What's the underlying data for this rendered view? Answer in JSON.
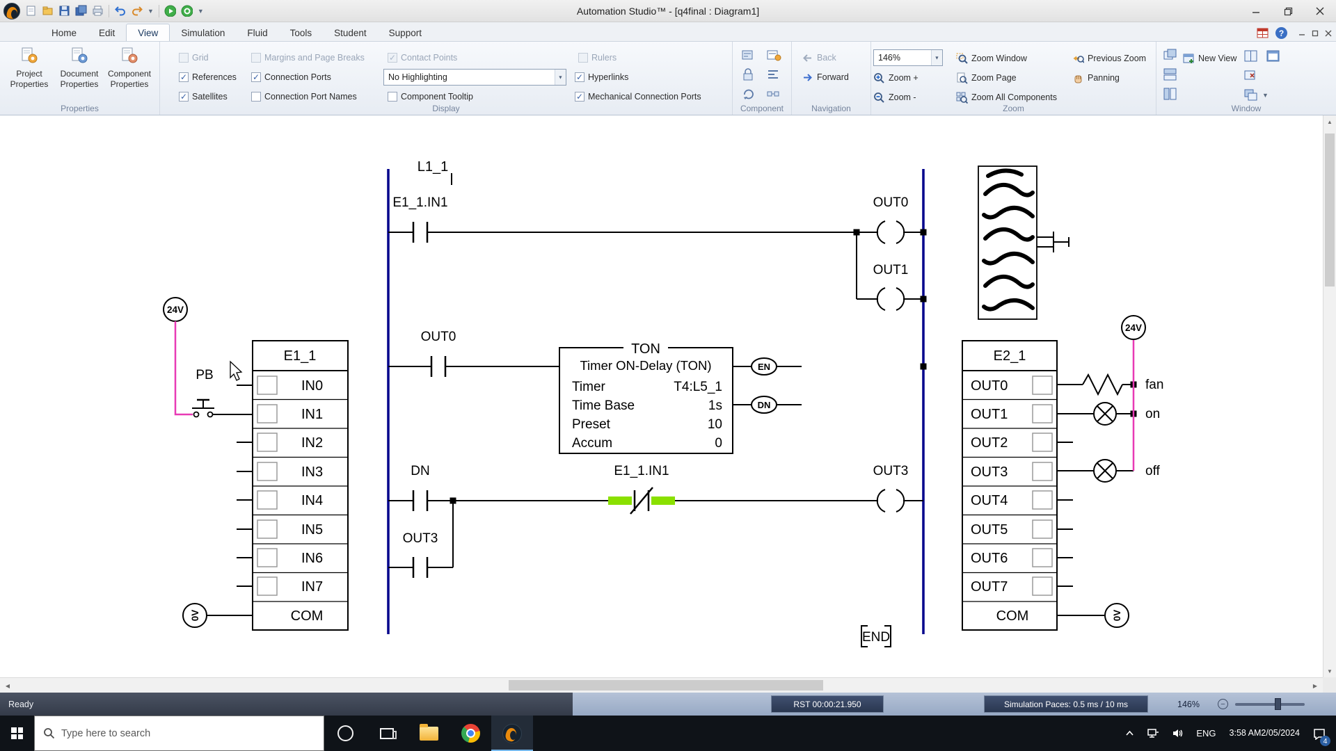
{
  "titlebar": {
    "title": "Automation Studio™ - [q4final : Diagram1]"
  },
  "menubar": {
    "tabs": [
      {
        "label": "Home"
      },
      {
        "label": "Edit"
      },
      {
        "label": "View"
      },
      {
        "label": "Simulation"
      },
      {
        "label": "Fluid"
      },
      {
        "label": "Tools"
      },
      {
        "label": "Student"
      },
      {
        "label": "Support"
      }
    ]
  },
  "ribbon": {
    "properties": {
      "label": "Properties",
      "project": "Project Properties",
      "document": "Document Properties",
      "component": "Component Properties"
    },
    "display": {
      "label": "Display",
      "grid": "Grid",
      "references": "References",
      "satellites": "Satellites",
      "margins": "Margins and Page Breaks",
      "connection_ports": "Connection Ports",
      "connection_port_names": "Connection Port Names",
      "contact_points": "Contact Points",
      "highlighting": "No Highlighting",
      "component_tooltip": "Component Tooltip",
      "rulers": "Rulers",
      "hyperlinks": "Hyperlinks",
      "mechanical": "Mechanical Connection Ports"
    },
    "component": {
      "label": "Component"
    },
    "navigation": {
      "label": "Navigation",
      "back": "Back",
      "forward": "Forward"
    },
    "zoom": {
      "label": "Zoom",
      "value": "146%",
      "window": "Zoom Window",
      "page": "Zoom Page",
      "plus": "Zoom +",
      "minus": "Zoom -",
      "all": "Zoom All Components",
      "previous": "Previous Zoom",
      "panning": "Panning"
    },
    "window": {
      "label": "Window",
      "new_view": "New View"
    }
  },
  "diagram": {
    "colors": {
      "rail": "#00008b",
      "wire": "#e83ab5",
      "highlight": "#8ae000"
    },
    "branch_label": "L1_1",
    "rung1": {
      "contact": "E1_1.IN1",
      "coil_a": "OUT0",
      "coil_b": "OUT1"
    },
    "rung2": {
      "contact": "OUT0",
      "en": "EN",
      "dn": "DN",
      "ton_title": "TON",
      "ton_subtitle": "Timer ON-Delay (TON)",
      "timer_label": "Timer",
      "timer_value": "T4:L5_1",
      "timebase_label": "Time Base",
      "timebase_value": "1s",
      "preset_label": "Preset",
      "preset_value": "10",
      "accum_label": "Accum",
      "accum_value": "0"
    },
    "rung3": {
      "contact_a": "DN",
      "contact_b": "OUT3",
      "nc_contact": "E1_1.IN1",
      "coil": "OUT3"
    },
    "end_label": "END",
    "left_module": {
      "title": "E1_1",
      "rows": [
        "IN0",
        "IN1",
        "IN2",
        "IN3",
        "IN4",
        "IN5",
        "IN6",
        "IN7"
      ],
      "com": "COM",
      "supply": "24V",
      "ground": "0V",
      "pb": "PB"
    },
    "right_module": {
      "title": "E2_1",
      "rows": [
        "OUT0",
        "OUT1",
        "OUT2",
        "OUT3",
        "OUT4",
        "OUT5",
        "OUT6",
        "OUT7"
      ],
      "com": "COM",
      "supply": "24V",
      "ground": "0V",
      "fan": "fan",
      "on": "on",
      "off": "off"
    }
  },
  "statusbar": {
    "ready": "Ready",
    "rst": "RST 00:00:21.950",
    "sim": "Simulation Paces: 0.5 ms / 10 ms",
    "zoom": "146%"
  },
  "taskbar": {
    "search_placeholder": "Type here to search",
    "lang": "ENG",
    "time": "3:58 AM",
    "date": "2/05/2024",
    "badge": "4"
  }
}
